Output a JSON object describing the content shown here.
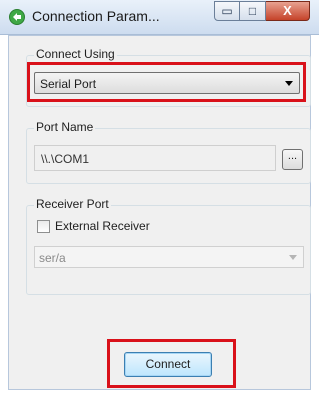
{
  "window": {
    "title": "Connection Param...",
    "minimize_label": "▭",
    "maximize_label": "□",
    "close_label": "X"
  },
  "connect_using": {
    "group_label": "Connect Using",
    "selected": "Serial Port"
  },
  "port_name": {
    "group_label": "Port Name",
    "value": "\\\\.\\COM1",
    "browse_label": "..."
  },
  "receiver_port": {
    "group_label": "Receiver Port",
    "external_receiver_label": "External Receiver",
    "external_receiver_checked": false,
    "port_value": "ser/a"
  },
  "connect_button_label": "Connect",
  "colors": {
    "highlight": "#d9111a",
    "titlebar": "#cddcef",
    "dialog_bg": "#f0f0f0"
  }
}
